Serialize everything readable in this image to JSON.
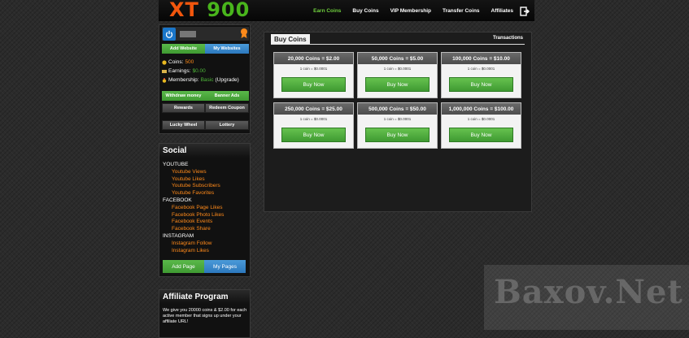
{
  "header": {
    "logo_part1": "XT",
    "logo_part2": "900",
    "nav": {
      "earn": "Earn Coins",
      "buy": "Buy Coins",
      "vip": "VIP Membership",
      "transfer": "Transfer Coins",
      "affiliates": "Affiliates"
    }
  },
  "user": {
    "add_website": "Add Website",
    "my_websites": "My Websites",
    "coins_label": "Coins:",
    "coins_value": "500",
    "earnings_label": "Earnings:",
    "earnings_value": "$0.00",
    "membership_label": "Membership:",
    "membership_value": "Basic",
    "upgrade": "(Upgrade)",
    "withdraw": "Withdraw money",
    "banner_ads": "Banner Ads",
    "rewards": "Rewards",
    "redeem": "Redeem Coupon",
    "lucky_wheel": "Lucky Wheel",
    "lottery": "Lottery"
  },
  "social": {
    "title": "Social",
    "youtube": "YOUTUBE",
    "yt_views": "Youtube Views",
    "yt_likes": "Youtube Likes",
    "yt_subs": "Youtube Subscribers",
    "yt_favs": "Youtube Favorites",
    "facebook": "FACEBOOK",
    "fb_page": "Facebook Page Likes",
    "fb_photo": "Facebook Photo Likes",
    "fb_events": "Facebook Events",
    "fb_share": "Facebook Share",
    "instagram": "INSTAGRAM",
    "ig_follow": "Instagram Follow",
    "ig_likes": "Instagram Likes",
    "add_page": "Add Page",
    "my_pages": "My Pages"
  },
  "affiliate": {
    "title": "Affiliate Program",
    "text": "We give you 20000 coins & $2.00 for each active member that signs up under your affiliate URL!"
  },
  "buy": {
    "tab": "Buy Coins",
    "transactions": "Transactions",
    "rate": "1 coin = $0.0001",
    "button": "Buy Now",
    "p1": "20,000 Coins = $2.00",
    "p2": "50,000 Coins = $5.00",
    "p3": "100,000 Coins = $10.00",
    "p4": "250,000 Coins = $25.00",
    "p5": "500,000 Coins = $50.00",
    "p6": "1,000,000 Coins = $100.00"
  },
  "watermark": "Baxov.Net",
  "colors": {
    "logo_orange": "#f2560d",
    "logo_green": "#49b51c",
    "nav_active": "#6fcf3d",
    "link_orange": "#ff8a1a",
    "button_green": "#4fa83c",
    "button_blue": "#2c78bd"
  },
  "icons": {
    "power": "power-icon",
    "award": "award-icon",
    "logout": "logout-icon",
    "coins": "coins-icon",
    "earnings": "money-icon",
    "membership": "medal-icon"
  }
}
